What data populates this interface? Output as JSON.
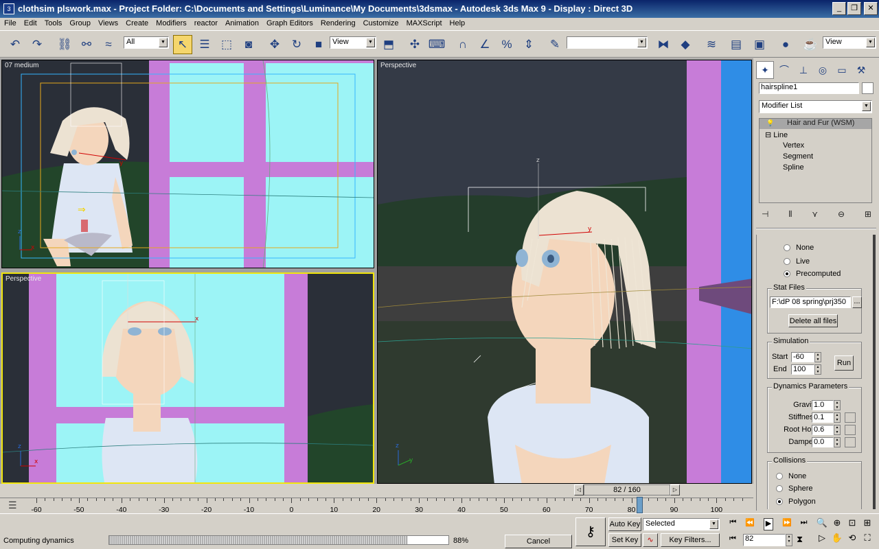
{
  "window": {
    "title": "clothsim plswork.max    - Project Folder: C:\\Documents and Settings\\Luminance\\My Documents\\3dsmax    - Autodesk 3ds Max 9    - Display : Direct 3D",
    "controls": [
      "_",
      "❐",
      "✕"
    ]
  },
  "menu": [
    "File",
    "Edit",
    "Tools",
    "Group",
    "Views",
    "Create",
    "Modifiers",
    "reactor",
    "Animation",
    "Graph Editors",
    "Rendering",
    "Customize",
    "MAXScript",
    "Help"
  ],
  "toolbar": {
    "selection_filter": "All",
    "ref_coord_1": "View",
    "named_selection": "",
    "ref_coord_2": "View"
  },
  "viewports": {
    "top_left": "07 medium",
    "bottom_left": "Perspective",
    "right": "Perspective"
  },
  "command_panel": {
    "object_name": "hairspline1",
    "modifier_list": "Modifier List",
    "stack": [
      {
        "label": "Hair and Fur (WSM)",
        "selected": true
      },
      {
        "label": "Line",
        "selected": false
      },
      {
        "label": "Vertex",
        "selected": false
      },
      {
        "label": "Segment",
        "selected": false
      },
      {
        "label": "Spline",
        "selected": false
      }
    ],
    "mode_options": [
      {
        "label": "None",
        "checked": false
      },
      {
        "label": "Live",
        "checked": false
      },
      {
        "label": "Precomputed",
        "checked": true
      }
    ],
    "stat_files": {
      "title": "Stat Files",
      "path": "F:\\dP 08 spring\\prj350",
      "browse": "...",
      "delete_button": "Delete all files"
    },
    "simulation": {
      "title": "Simulation",
      "start_label": "Start",
      "start_value": "-60",
      "end_label": "End",
      "end_value": "100",
      "run_button": "Run"
    },
    "dynamics": {
      "title": "Dynamics Parameters",
      "params": [
        {
          "label": "Gravity",
          "value": "1.0"
        },
        {
          "label": "Stiffness",
          "value": "0.1"
        },
        {
          "label": "Root Hold",
          "value": "0.6"
        },
        {
          "label": "Dampen",
          "value": "0.0"
        }
      ]
    },
    "collisions": {
      "title": "Collisions",
      "options": [
        {
          "label": "None",
          "checked": false
        },
        {
          "label": "Sphere",
          "checked": false
        },
        {
          "label": "Polygon",
          "checked": true
        }
      ]
    }
  },
  "timeline": {
    "frame_display": "82 / 160",
    "ticks": [
      "-60",
      "-50",
      "-40",
      "-30",
      "-20",
      "-10",
      "0",
      "10",
      "20",
      "30",
      "40",
      "50",
      "60",
      "70",
      "80",
      "90",
      "100"
    ],
    "current_frame": 82
  },
  "status": {
    "message": "Computing dynamics",
    "progress_percent": "88%",
    "progress_value": 0.88,
    "cancel_button": "Cancel",
    "auto_key": "Auto Key",
    "set_key": "Set Key",
    "key_mode": "Selected",
    "key_filters": "Key Filters...",
    "frame_field": "82"
  },
  "colors": {
    "title_start": "#0a246a",
    "title_end": "#3a6ea5",
    "active_viewport_border": "#f2e60a",
    "window_frame_purple": "#c77cd8",
    "glass_cyan": "#9cf4f6"
  }
}
